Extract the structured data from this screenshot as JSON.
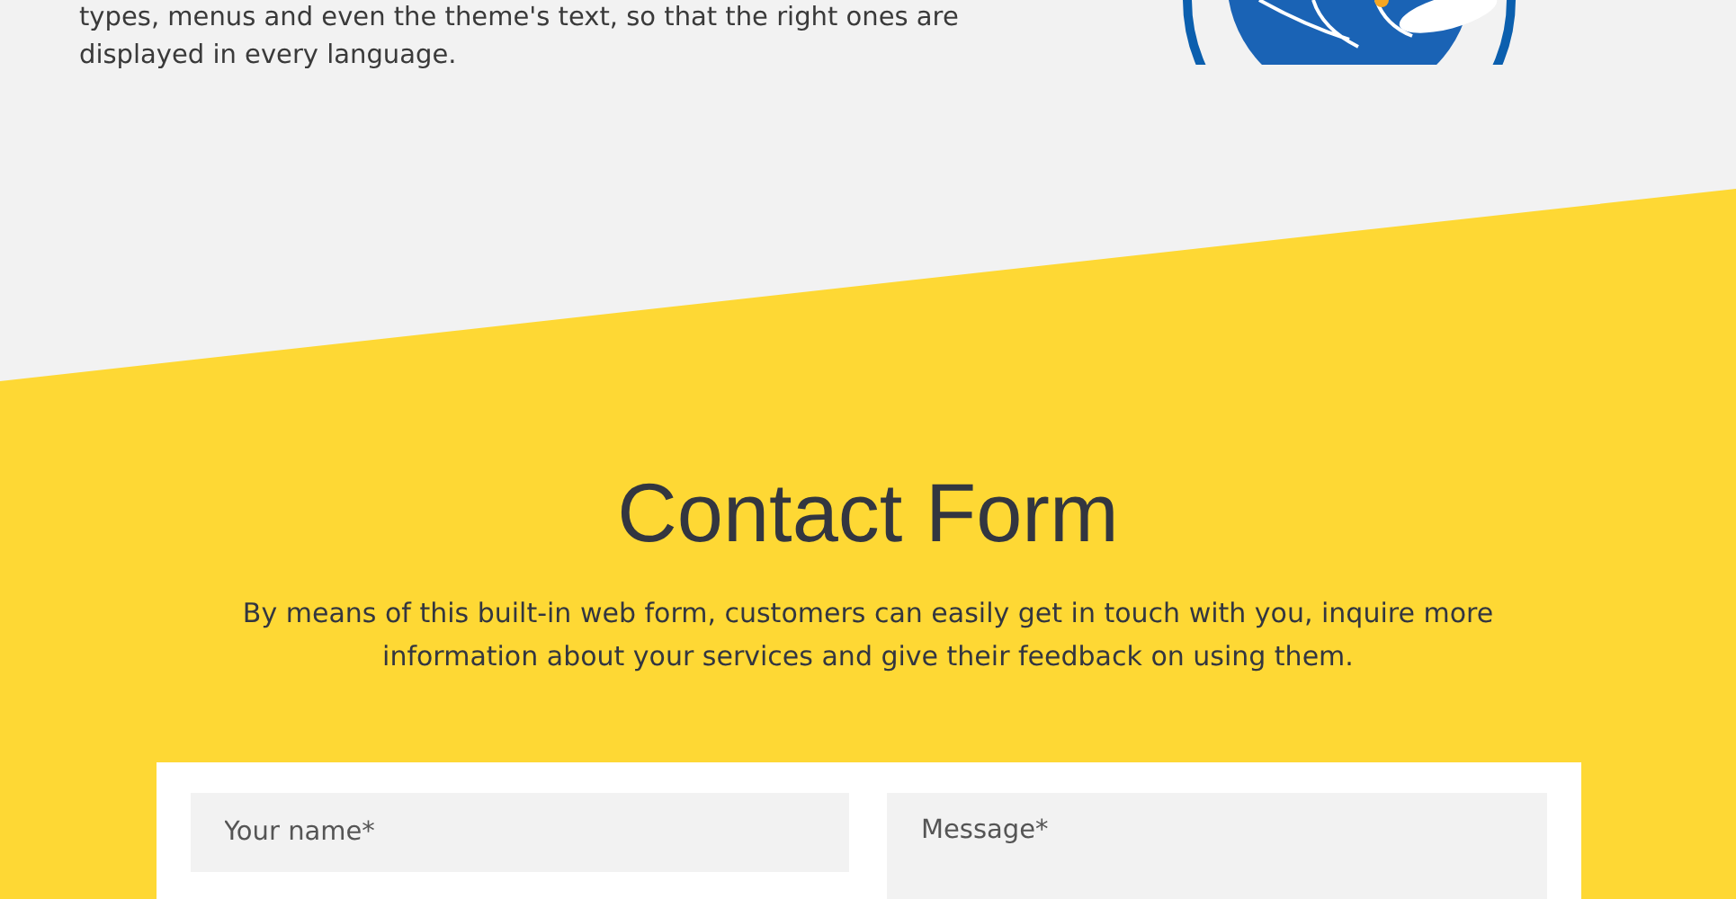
{
  "intro": {
    "text": "types, menus and even the theme's text, so that the right ones are displayed in every language."
  },
  "contact": {
    "title": "Contact Form",
    "description": "By means of this built-in web form, customers can easily get in touch with you, inquire more information about your services and give their feedback on using them."
  },
  "form": {
    "name_field": {
      "placeholder": "Your name*"
    },
    "message_field": {
      "placeholder": "Message*"
    }
  }
}
